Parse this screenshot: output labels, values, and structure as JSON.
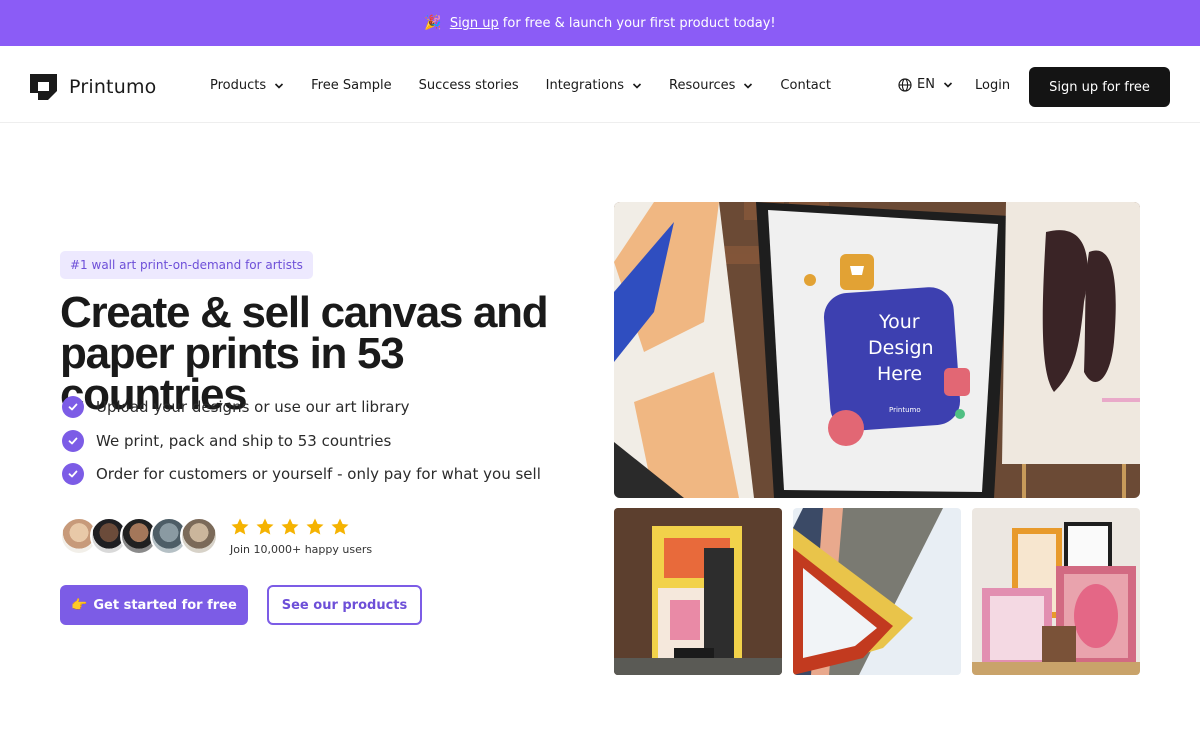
{
  "banner": {
    "emoji": "🎉",
    "link_text": "Sign up",
    "text": "for free & launch your first product today!"
  },
  "header": {
    "brand": "Printumo",
    "nav": {
      "products": "Products",
      "free_sample": "Free Sample",
      "success_stories": "Success stories",
      "integrations": "Integrations",
      "resources": "Resources",
      "contact": "Contact"
    },
    "language": "EN",
    "login": "Login",
    "signup": "Sign up for free"
  },
  "hero": {
    "tag": "#1 wall art print-on-demand for artists",
    "headline_line1": "Create & sell canvas and",
    "headline_line2": "paper prints in 53 countries",
    "bullets": [
      "Upload your designs or use our art library",
      "We print, pack and ship to 53 countries",
      "Order for customers or yourself - only pay for what you sell"
    ],
    "rating_stars": 5,
    "social_proof": "Join 10,000+ happy users",
    "cta_primary_emoji": "👉",
    "cta_primary": "Get started for free",
    "cta_secondary": "See our products"
  },
  "images": {
    "mockup_line1": "Your",
    "mockup_line2": "Design",
    "mockup_line3": "Here",
    "mockup_brand": "Printumo"
  },
  "colors": {
    "accent": "#7c5ce6",
    "banner": "#8b5cf6",
    "tag_bg": "#ede9fe",
    "dark_button": "#141414",
    "star": "#f5b301"
  }
}
